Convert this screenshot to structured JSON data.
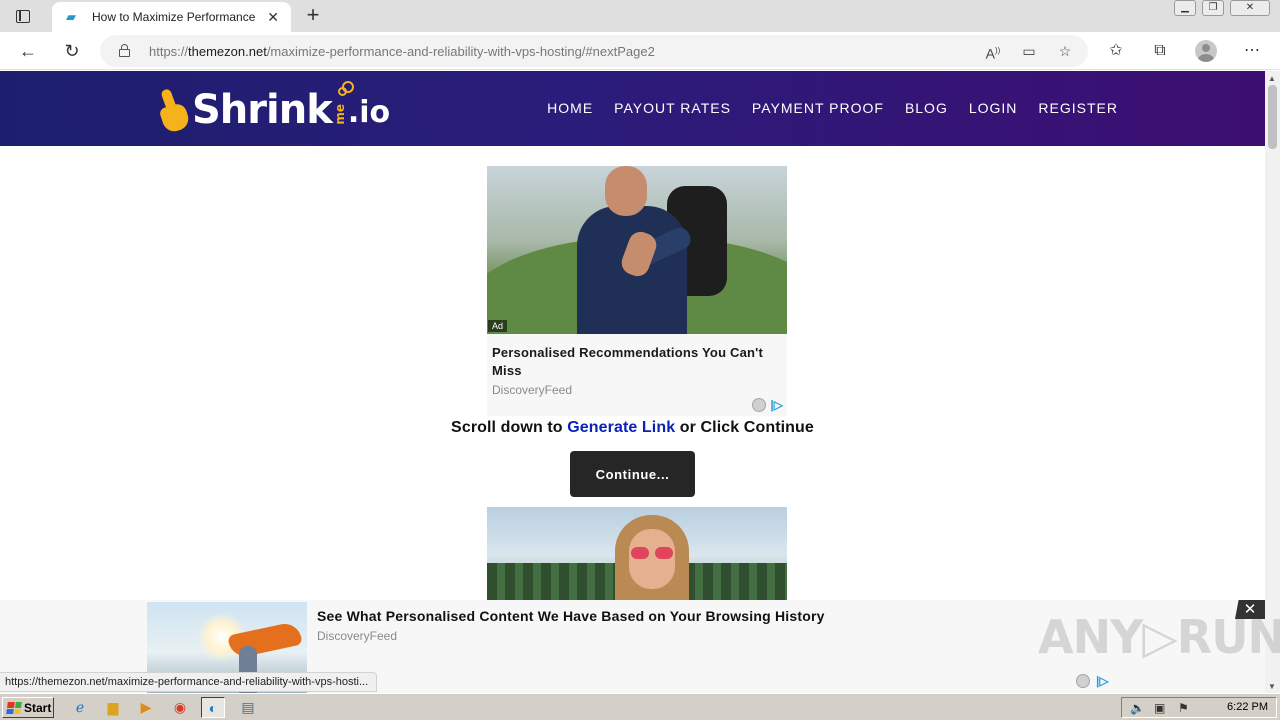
{
  "browser": {
    "tab_title": "How to Maximize Performance and Reliability with VPS Hosting",
    "tab_close": "✕",
    "new_tab": "+",
    "url_scheme": "https://",
    "url_host": "themezon.net",
    "url_path": "/maximize-performance-and-reliability-with-vps-hosting/#nextPage2",
    "window_buttons": [
      "▁",
      "❐",
      "✕"
    ]
  },
  "site": {
    "logo_text": "Shrink",
    "logo_me": "me",
    "logo_tld": ".io",
    "nav": [
      "HOME",
      "PAYOUT RATES",
      "PAYMENT PROOF",
      "BLOG",
      "LOGIN",
      "REGISTER"
    ]
  },
  "ad_card": {
    "badge": "Ad",
    "headline": "Personalised Recommendations You Can't Miss",
    "source": "DiscoveryFeed"
  },
  "cta": {
    "prefix": "Scroll down to ",
    "link": "Generate Link",
    "suffix": " or Click Continue",
    "button": "Continue..."
  },
  "bottom_ad": {
    "title": "See What Personalised Content We Have Based on Your Browsing History",
    "source": "DiscoveryFeed",
    "close": "✕",
    "watermark": "ANY▷RUN"
  },
  "status_bar": {
    "url": "https://themezon.net/maximize-performance-and-reliability-with-vps-hosti..."
  },
  "taskbar": {
    "start": "Start",
    "clock": "6:22 PM"
  },
  "colors": {
    "header_gradient_start": "#1d1f6e",
    "header_gradient_end": "#3d0e72",
    "logo_accent": "#f6b21b",
    "link_blue": "#0a22b8",
    "button_dark": "#262626"
  }
}
